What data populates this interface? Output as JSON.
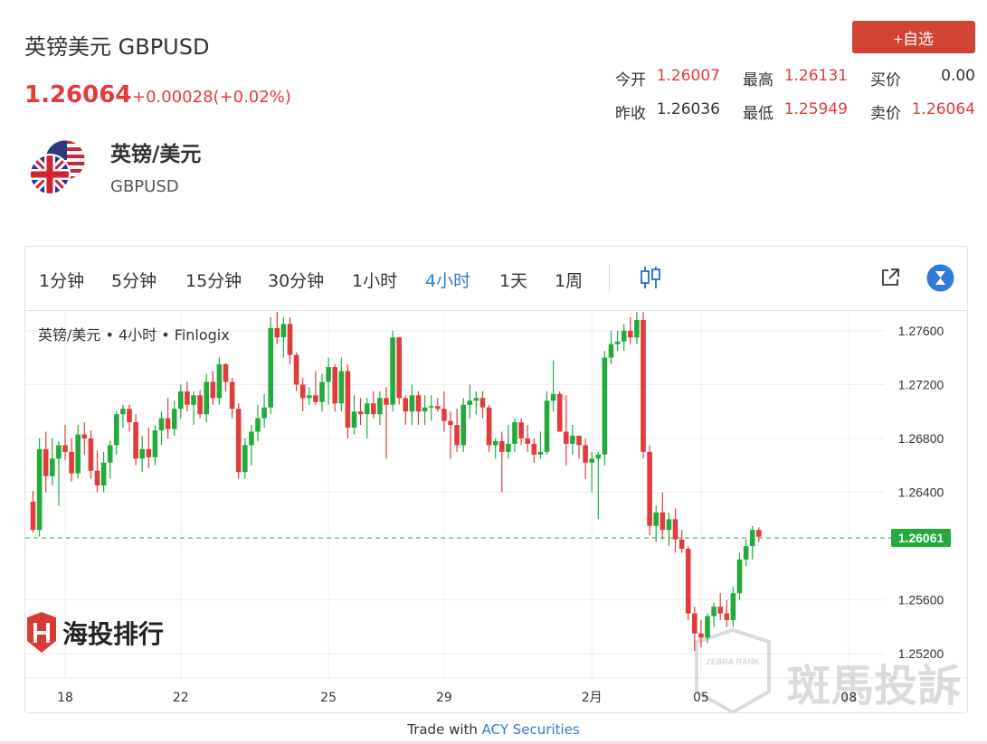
{
  "header": {
    "title": "英镑美元 GBPUSD",
    "price": "1.26064",
    "change": "+0.00028(+0.02%)",
    "add_button": "+自选"
  },
  "quote": {
    "open_label": "今开",
    "open": "1.26007",
    "high_label": "最高",
    "high": "1.26131",
    "bid_label": "买价",
    "bid": "0.00",
    "prev_close_label": "昨收",
    "prev_close": "1.26036",
    "low_label": "最低",
    "low": "1.25949",
    "ask_label": "卖价",
    "ask": "1.26064"
  },
  "pair": {
    "name": "英镑/美元",
    "code": "GBPUSD"
  },
  "timeframes": [
    "1分钟",
    "5分钟",
    "15分钟",
    "30分钟",
    "1小时",
    "4小时",
    "1天",
    "1周"
  ],
  "active_timeframe": "4小时",
  "chart_header": "英镑/美元 • 4小时 • Finlogix",
  "watermark_left": "海投排行",
  "watermark_right": "斑馬投訴",
  "watermark_shield_text": "ZEBRA RANK",
  "footer": {
    "prefix": "Trade with ",
    "brand": "ACY Securities"
  },
  "colors": {
    "up": "#22ab3a",
    "down": "#e23b3b",
    "accent": "#2f7bd6",
    "button": "#d14434"
  },
  "chart_data": {
    "type": "candlestick",
    "title": "英镑/美元 • 4小时 • Finlogix",
    "yticks": [
      1.276,
      1.272,
      1.268,
      1.264,
      1.256,
      1.252
    ],
    "ytick_labels": [
      "1.27600",
      "1.27200",
      "1.26800",
      "1.26400",
      "1.25600",
      "1.25200"
    ],
    "ylim": [
      1.2502,
      1.2774
    ],
    "xticks": [
      {
        "index": 5,
        "label": "18"
      },
      {
        "index": 23,
        "label": "22"
      },
      {
        "index": 46,
        "label": "25"
      },
      {
        "index": 64,
        "label": "29"
      },
      {
        "index": 87,
        "label": "2月"
      },
      {
        "index": 104,
        "label": "05"
      },
      {
        "index": 127,
        "label": "08"
      }
    ],
    "current_price": 1.26061,
    "current_price_label": "1.26061",
    "grid": true,
    "ohlc": [
      [
        1.2633,
        1.2641,
        1.261,
        1.2612
      ],
      [
        1.2612,
        1.268,
        1.2607,
        1.2672
      ],
      [
        1.2672,
        1.2685,
        1.264,
        1.2652
      ],
      [
        1.2652,
        1.268,
        1.2645,
        1.2665
      ],
      [
        1.2665,
        1.2678,
        1.263,
        1.2675
      ],
      [
        1.2675,
        1.269,
        1.2664,
        1.267
      ],
      [
        1.267,
        1.268,
        1.2648,
        1.2654
      ],
      [
        1.2654,
        1.269,
        1.265,
        1.2683
      ],
      [
        1.2683,
        1.2692,
        1.2668,
        1.268
      ],
      [
        1.268,
        1.2686,
        1.265,
        1.2656
      ],
      [
        1.2656,
        1.2671,
        1.264,
        1.2645
      ],
      [
        1.2645,
        1.267,
        1.264,
        1.2662
      ],
      [
        1.2662,
        1.2678,
        1.265,
        1.2675
      ],
      [
        1.2675,
        1.27,
        1.2668,
        1.2698
      ],
      [
        1.2698,
        1.2705,
        1.2688,
        1.2702
      ],
      [
        1.2702,
        1.2705,
        1.2685,
        1.2692
      ],
      [
        1.2692,
        1.2698,
        1.266,
        1.2665
      ],
      [
        1.2665,
        1.2682,
        1.2655,
        1.2672
      ],
      [
        1.2672,
        1.2688,
        1.2658,
        1.2666
      ],
      [
        1.2666,
        1.269,
        1.266,
        1.2686
      ],
      [
        1.2686,
        1.27,
        1.2675,
        1.2695
      ],
      [
        1.2695,
        1.271,
        1.268,
        1.2687
      ],
      [
        1.2687,
        1.2708,
        1.2682,
        1.2702
      ],
      [
        1.2702,
        1.272,
        1.2695,
        1.2715
      ],
      [
        1.2715,
        1.2722,
        1.27,
        1.2705
      ],
      [
        1.2705,
        1.2715,
        1.269,
        1.2712
      ],
      [
        1.2712,
        1.2716,
        1.2695,
        1.2698
      ],
      [
        1.2698,
        1.2728,
        1.2692,
        1.2722
      ],
      [
        1.2722,
        1.273,
        1.2705,
        1.271
      ],
      [
        1.271,
        1.274,
        1.2705,
        1.2735
      ],
      [
        1.2735,
        1.2736,
        1.2715,
        1.2722
      ],
      [
        1.2722,
        1.2725,
        1.2695,
        1.2702
      ],
      [
        1.2702,
        1.2706,
        1.265,
        1.2655
      ],
      [
        1.2655,
        1.268,
        1.265,
        1.2675
      ],
      [
        1.2675,
        1.269,
        1.266,
        1.2685
      ],
      [
        1.2685,
        1.2705,
        1.2678,
        1.2695
      ],
      [
        1.2695,
        1.2713,
        1.2688,
        1.2703
      ],
      [
        1.2703,
        1.277,
        1.2698,
        1.2762
      ],
      [
        1.2762,
        1.2775,
        1.275,
        1.2755
      ],
      [
        1.2755,
        1.277,
        1.274,
        1.2765
      ],
      [
        1.2765,
        1.277,
        1.2735,
        1.2742
      ],
      [
        1.2742,
        1.2744,
        1.2715,
        1.272
      ],
      [
        1.272,
        1.2725,
        1.27,
        1.271
      ],
      [
        1.271,
        1.2718,
        1.2705,
        1.2712
      ],
      [
        1.2712,
        1.273,
        1.2705,
        1.2707
      ],
      [
        1.2707,
        1.2728,
        1.27,
        1.2722
      ],
      [
        1.2722,
        1.274,
        1.2705,
        1.2733
      ],
      [
        1.2733,
        1.2735,
        1.27,
        1.2706
      ],
      [
        1.2706,
        1.274,
        1.27,
        1.273
      ],
      [
        1.273,
        1.2735,
        1.268,
        1.2688
      ],
      [
        1.2688,
        1.2712,
        1.2683,
        1.27
      ],
      [
        1.27,
        1.271,
        1.269,
        1.2698
      ],
      [
        1.2698,
        1.271,
        1.268,
        1.2706
      ],
      [
        1.2706,
        1.2715,
        1.2695,
        1.2698
      ],
      [
        1.2698,
        1.2715,
        1.269,
        1.271
      ],
      [
        1.271,
        1.2718,
        1.2665,
        1.2705
      ],
      [
        1.2705,
        1.276,
        1.27,
        1.2755
      ],
      [
        1.2755,
        1.2755,
        1.2705,
        1.271
      ],
      [
        1.271,
        1.2712,
        1.269,
        1.27
      ],
      [
        1.27,
        1.272,
        1.269,
        1.2712
      ],
      [
        1.2712,
        1.2715,
        1.269,
        1.27
      ],
      [
        1.27,
        1.2712,
        1.269,
        1.2703
      ],
      [
        1.2703,
        1.2712,
        1.2693,
        1.2704
      ],
      [
        1.2704,
        1.271,
        1.27,
        1.2702
      ],
      [
        1.2702,
        1.2715,
        1.2685,
        1.2693
      ],
      [
        1.2693,
        1.27,
        1.2665,
        1.269
      ],
      [
        1.269,
        1.2702,
        1.267,
        1.2675
      ],
      [
        1.2675,
        1.271,
        1.267,
        1.2705
      ],
      [
        1.2705,
        1.272,
        1.2695,
        1.2708
      ],
      [
        1.2708,
        1.2715,
        1.2698,
        1.271
      ],
      [
        1.271,
        1.2715,
        1.2695,
        1.2703
      ],
      [
        1.2703,
        1.2705,
        1.267,
        1.2675
      ],
      [
        1.2675,
        1.268,
        1.2665,
        1.2678
      ],
      [
        1.2678,
        1.2685,
        1.264,
        1.267
      ],
      [
        1.267,
        1.269,
        1.2665,
        1.2676
      ],
      [
        1.2676,
        1.2695,
        1.267,
        1.2692
      ],
      [
        1.2692,
        1.2695,
        1.2675,
        1.268
      ],
      [
        1.268,
        1.269,
        1.267,
        1.2676
      ],
      [
        1.2676,
        1.268,
        1.2662,
        1.2668
      ],
      [
        1.2668,
        1.2685,
        1.2665,
        1.267
      ],
      [
        1.267,
        1.2715,
        1.2668,
        1.2708
      ],
      [
        1.2708,
        1.2738,
        1.27,
        1.2713
      ],
      [
        1.2713,
        1.2715,
        1.269,
        1.2685
      ],
      [
        1.2685,
        1.2712,
        1.266,
        1.2676
      ],
      [
        1.2676,
        1.269,
        1.2668,
        1.2682
      ],
      [
        1.2682,
        1.2682,
        1.2665,
        1.2675
      ],
      [
        1.2675,
        1.268,
        1.265,
        1.2662
      ],
      [
        1.2662,
        1.267,
        1.264,
        1.2665
      ],
      [
        1.2665,
        1.267,
        1.262,
        1.2668
      ],
      [
        1.2668,
        1.2745,
        1.266,
        1.274
      ],
      [
        1.274,
        1.276,
        1.2735,
        1.275
      ],
      [
        1.275,
        1.276,
        1.2745,
        1.2752
      ],
      [
        1.2752,
        1.2765,
        1.2745,
        1.276
      ],
      [
        1.276,
        1.277,
        1.275,
        1.2755
      ],
      [
        1.2755,
        1.2775,
        1.275,
        1.2768
      ],
      [
        1.2768,
        1.2775,
        1.2665,
        1.267
      ],
      [
        1.267,
        1.2675,
        1.2608,
        1.2615
      ],
      [
        1.2615,
        1.263,
        1.2603,
        1.2625
      ],
      [
        1.2625,
        1.264,
        1.2605,
        1.2612
      ],
      [
        1.2612,
        1.2625,
        1.26,
        1.262
      ],
      [
        1.262,
        1.2628,
        1.2595,
        1.2605
      ],
      [
        1.2605,
        1.2612,
        1.2595,
        1.2598
      ],
      [
        1.2598,
        1.26,
        1.2545,
        1.255
      ],
      [
        1.255,
        1.2555,
        1.2522,
        1.2535
      ],
      [
        1.2535,
        1.2545,
        1.2525,
        1.2532
      ],
      [
        1.2532,
        1.255,
        1.2528,
        1.2548
      ],
      [
        1.2548,
        1.2558,
        1.254,
        1.2555
      ],
      [
        1.2555,
        1.2565,
        1.2545,
        1.255
      ],
      [
        1.255,
        1.256,
        1.254,
        1.2545
      ],
      [
        1.2545,
        1.257,
        1.254,
        1.2565
      ],
      [
        1.2565,
        1.2595,
        1.256,
        1.259
      ],
      [
        1.259,
        1.2605,
        1.2585,
        1.26
      ],
      [
        1.26,
        1.2615,
        1.259,
        1.2612
      ],
      [
        1.2612,
        1.2614,
        1.2603,
        1.2607
      ]
    ]
  }
}
